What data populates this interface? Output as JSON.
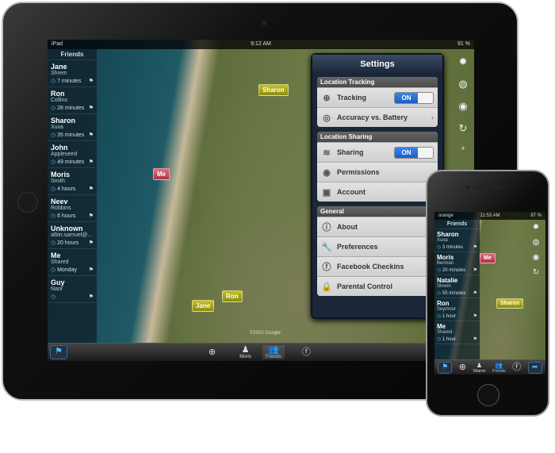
{
  "ipad": {
    "status": {
      "carrier": "iPad",
      "time": "9:12 AM",
      "battery": "91 %"
    },
    "sidebar": {
      "title": "Friends",
      "friends": [
        {
          "first": "Jane",
          "last": "Shrem",
          "time": "7 minutes"
        },
        {
          "first": "Ron",
          "last": "Collins",
          "time": "28 minutes"
        },
        {
          "first": "Sharon",
          "last": "Xuxa",
          "time": "35 minutes"
        },
        {
          "first": "John",
          "last": "Appleseed",
          "time": "49 minutes"
        },
        {
          "first": "Moris",
          "last": "Smith",
          "time": "4 hours"
        },
        {
          "first": "Neev",
          "last": "Robbins",
          "time": "6 hours"
        },
        {
          "first": "Unknown",
          "last": "albin.samuel@...",
          "time": "20 hours"
        },
        {
          "first": "Me",
          "last": "Shared",
          "time": "Monday"
        },
        {
          "first": "Guy",
          "last": "Naor",
          "time": ""
        }
      ]
    },
    "map_pins": {
      "sharon": "Sharon",
      "me": "Me",
      "ron": "Ron",
      "jane": "Jane",
      "copyright": "©2010 Google"
    },
    "toolbar": {
      "moris": "Moris",
      "friends": "Friends"
    },
    "settings": {
      "title": "Settings",
      "groups": [
        {
          "header": "Location Tracking",
          "rows": [
            {
              "label": "Tracking",
              "value": "ON",
              "icon": "crosshair-icon"
            },
            {
              "label": "Accuracy vs. Battery",
              "icon": "target-icon"
            }
          ]
        },
        {
          "header": "Location Sharing",
          "rows": [
            {
              "label": "Sharing",
              "value": "ON",
              "icon": "wifi-icon"
            },
            {
              "label": "Permissions",
              "icon": "eye-icon"
            },
            {
              "label": "Account",
              "icon": "account-icon"
            }
          ]
        },
        {
          "header": "General",
          "rows": [
            {
              "label": "About",
              "icon": "info-icon"
            },
            {
              "label": "Preferences",
              "icon": "wrench-icon"
            },
            {
              "label": "Facebook Checkins",
              "value": "Of",
              "icon": "facebook-icon"
            },
            {
              "label": "Parental Control",
              "value": "Of",
              "icon": "lock-icon"
            }
          ]
        }
      ]
    }
  },
  "iphone": {
    "status": {
      "carrier": "orange",
      "time": "11:53 AM",
      "battery": "87 %"
    },
    "sidebar": {
      "title": "Friends",
      "friends": [
        {
          "first": "Sharon",
          "last": "Xuxa",
          "time": "3 minutes"
        },
        {
          "first": "Moris",
          "last": "Berman",
          "time": "20 minutes"
        },
        {
          "first": "Natalie",
          "last": "Shrem",
          "time": "55 minutes"
        },
        {
          "first": "Ron",
          "last": "Seymour",
          "time": "1 hour"
        },
        {
          "first": "Me",
          "last": "Shared",
          "time": "1 hour"
        }
      ]
    },
    "map_pins": {
      "me": "Me",
      "sharon": "Sharon"
    },
    "toolbar": {
      "sharon": "Sharon",
      "friends": "Friends"
    }
  }
}
